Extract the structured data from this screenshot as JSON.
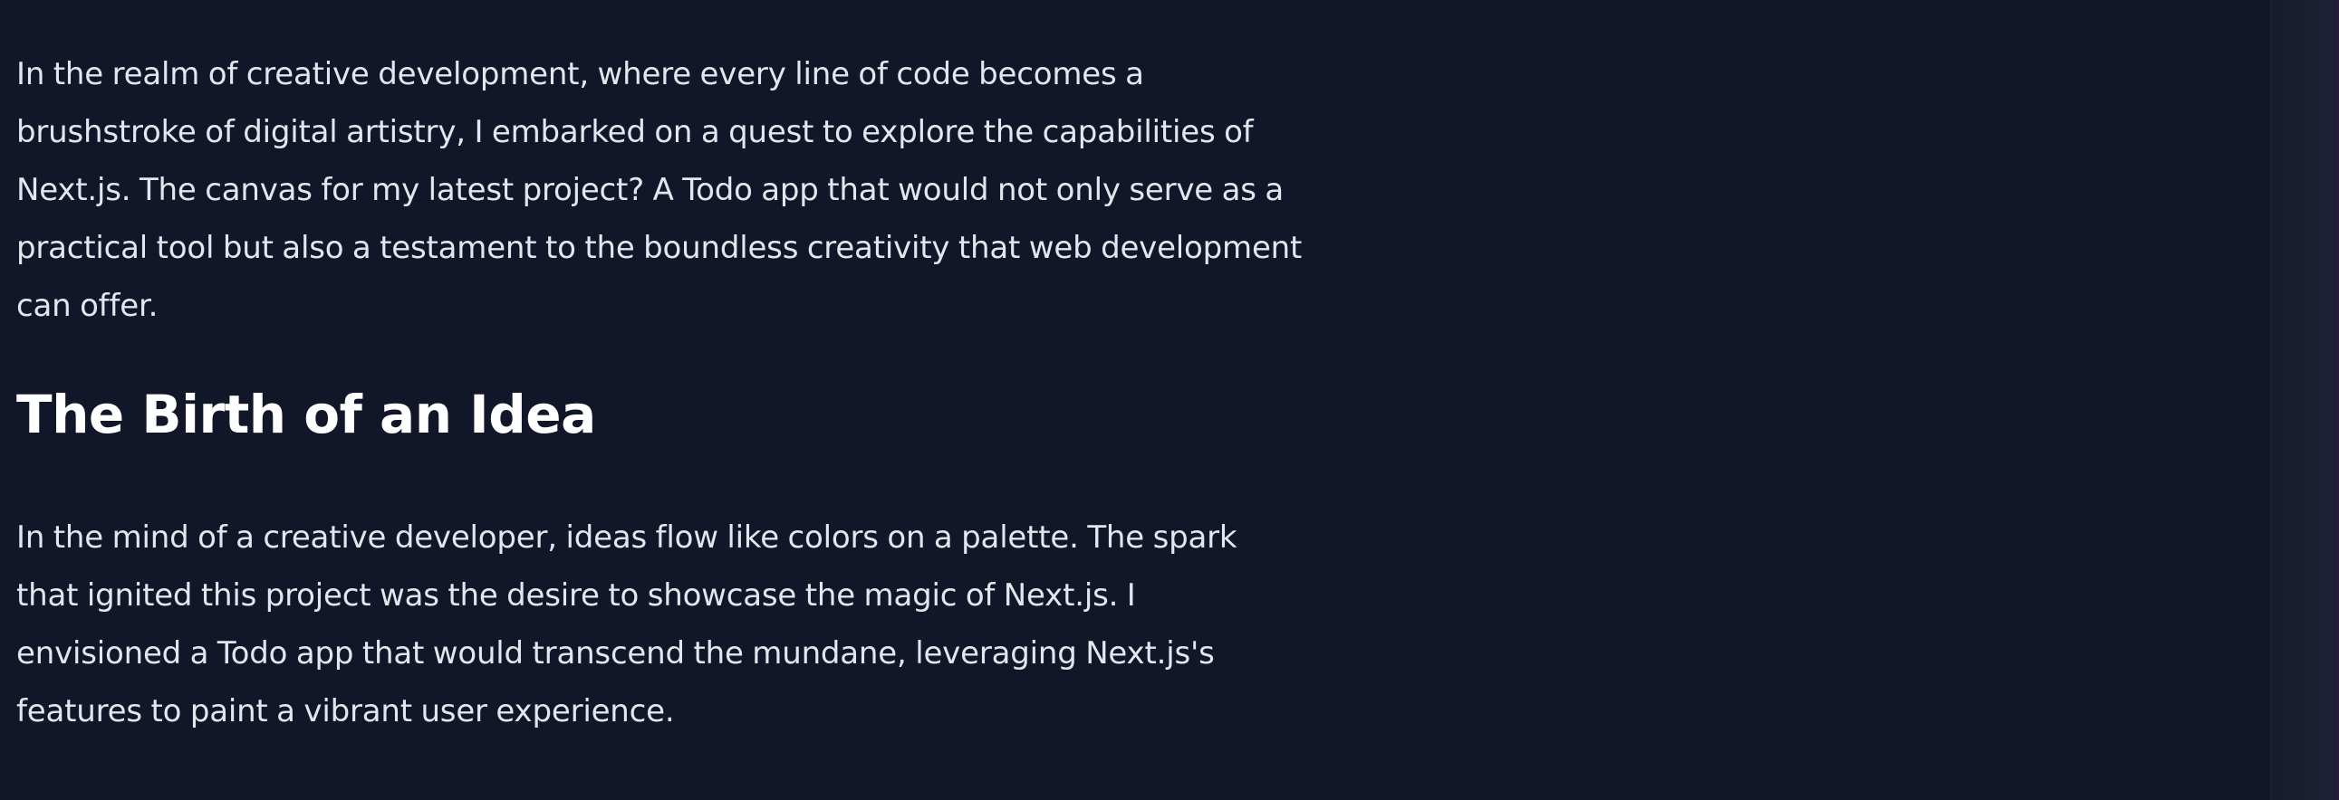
{
  "article": {
    "intro_paragraph": "In the realm of creative development, where every line of code becomes a brushstroke of digital artistry, I embarked on a quest to explore the capabilities of Next.js. The canvas for my latest project? A Todo app that would not only serve as a practical tool but also a testament to the boundless creativity that web development can offer.",
    "section_heading": "The Birth of an Idea",
    "section_paragraph": "In the mind of a creative developer, ideas flow like colors on a palette. The spark that ignited this project was the desire to showcase the magic of Next.js. I envisioned a Todo app that would transcend the mundane, leveraging Next.js's features to paint a vibrant user experience."
  },
  "colors": {
    "background": "#111729",
    "text": "#e4e6ed",
    "heading": "#ffffff"
  }
}
